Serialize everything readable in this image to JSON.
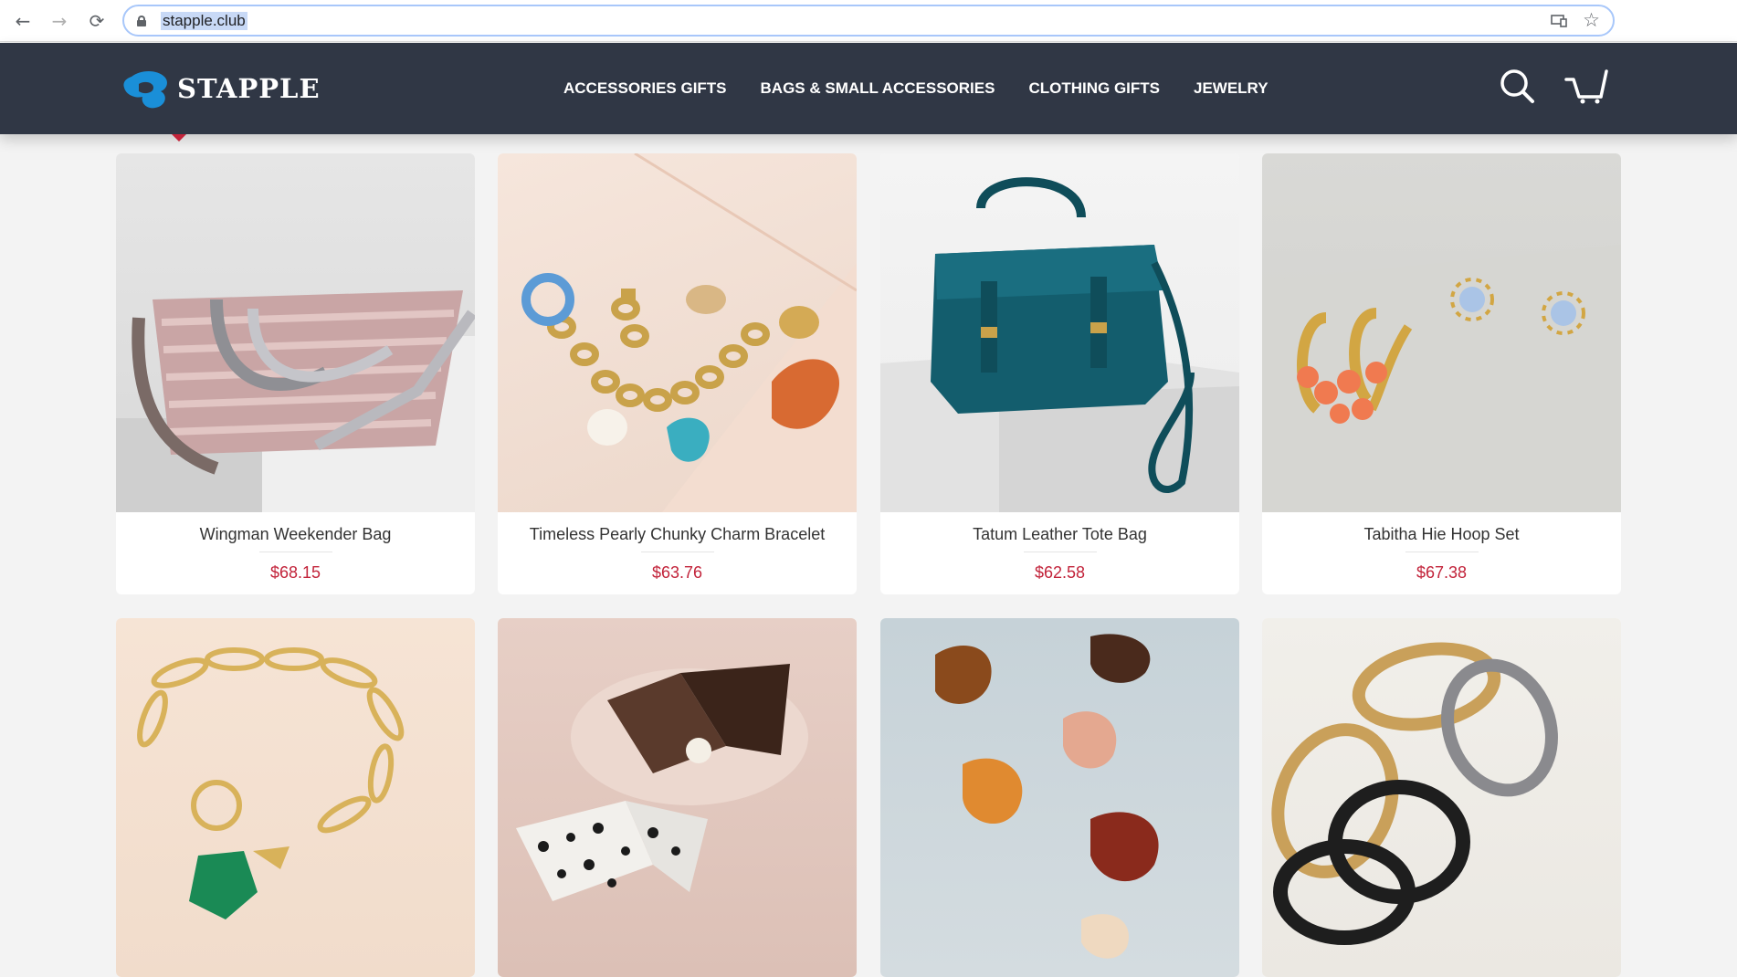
{
  "browser": {
    "url": "stapple.club",
    "back_icon": "←",
    "forward_icon": "→",
    "reload_icon": "⟳",
    "star_icon": "☆"
  },
  "header": {
    "logo_text": "STAPPLE",
    "brand_color": "#1a8fd8",
    "nav": [
      {
        "label": "ACCESSORIES GIFTS"
      },
      {
        "label": "BAGS & SMALL ACCESSORIES"
      },
      {
        "label": "CLOTHING GIFTS"
      },
      {
        "label": "JEWELRY"
      }
    ]
  },
  "products": [
    {
      "name": "Wingman Weekender Bag",
      "price": "$68.15"
    },
    {
      "name": "Timeless Pearly Chunky Charm Bracelet",
      "price": "$63.76"
    },
    {
      "name": "Tatum Leather Tote Bag",
      "price": "$62.58"
    },
    {
      "name": "Tabitha Hie Hoop Set",
      "price": "$67.38"
    }
  ],
  "colors": {
    "header_bg": "#303745",
    "price": "#c2233a",
    "page_bg": "#f3f3f3"
  }
}
